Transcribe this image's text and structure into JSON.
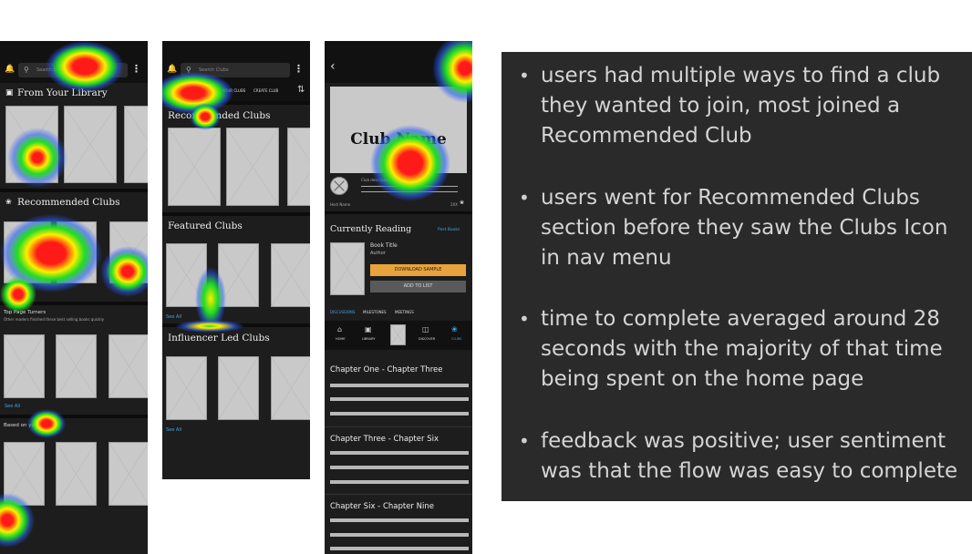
{
  "screen1": {
    "search_placeholder": "Search Books",
    "library_title": "From Your Library",
    "recommended_title": "Recommended Clubs",
    "top_page_turners_title": "Top Page Turners",
    "top_page_turners_sub": "Other readers finished these best selling books quickly",
    "see_all": "See All",
    "based_on_title": "Based on you"
  },
  "screen2": {
    "search_placeholder": "Search Clubs",
    "filter_your_clubs": "YOUR CLUBS",
    "filter_create_club": "CREATE CLUB",
    "recommended_title": "Recommended Clubs",
    "featured_title": "Featured Clubs",
    "see_all": "See All",
    "influencer_title": "Influencer Led Clubs",
    "see_all_2": "See All"
  },
  "screen3": {
    "club_name": "Club Name",
    "club_description": "Club description",
    "host_name": "Host Name",
    "member_count": "2XX",
    "currently_reading": "Currently Reading",
    "past_books": "Past Books",
    "book_title": "Book Title",
    "author": "Author",
    "download_sample": "DOWNLOAD SAMPLE",
    "add_to_list": "ADD TO LIST",
    "tabs": [
      "DISCUSSIONS",
      "MILESTONES",
      "MEETINGS"
    ],
    "nav": [
      "HOME",
      "LIBRARY",
      "",
      "DISCOVER",
      "CLUBS"
    ],
    "chapters": [
      "Chapter One - Chapter Three",
      "Chapter Three - Chapter Six",
      "Chapter Six - Chapter Nine"
    ]
  },
  "notes": [
    "users had multiple ways to find a club they wanted to join, most joined a Recommended Club",
    "users went for Recommended Clubs section before they saw the Clubs Icon in nav menu",
    "time to complete averaged around 28 seconds with the majority of that time being spent on the home page",
    "feedback was  positive; user sentiment was that the flow was easy to complete"
  ],
  "colors": {
    "phone_bg": "#1d1d1d",
    "accent_blue": "#3fa7e0",
    "download_button": "#e8a33c",
    "add_button": "#5a5a5a",
    "notes_bg": "#2a2a2a"
  }
}
